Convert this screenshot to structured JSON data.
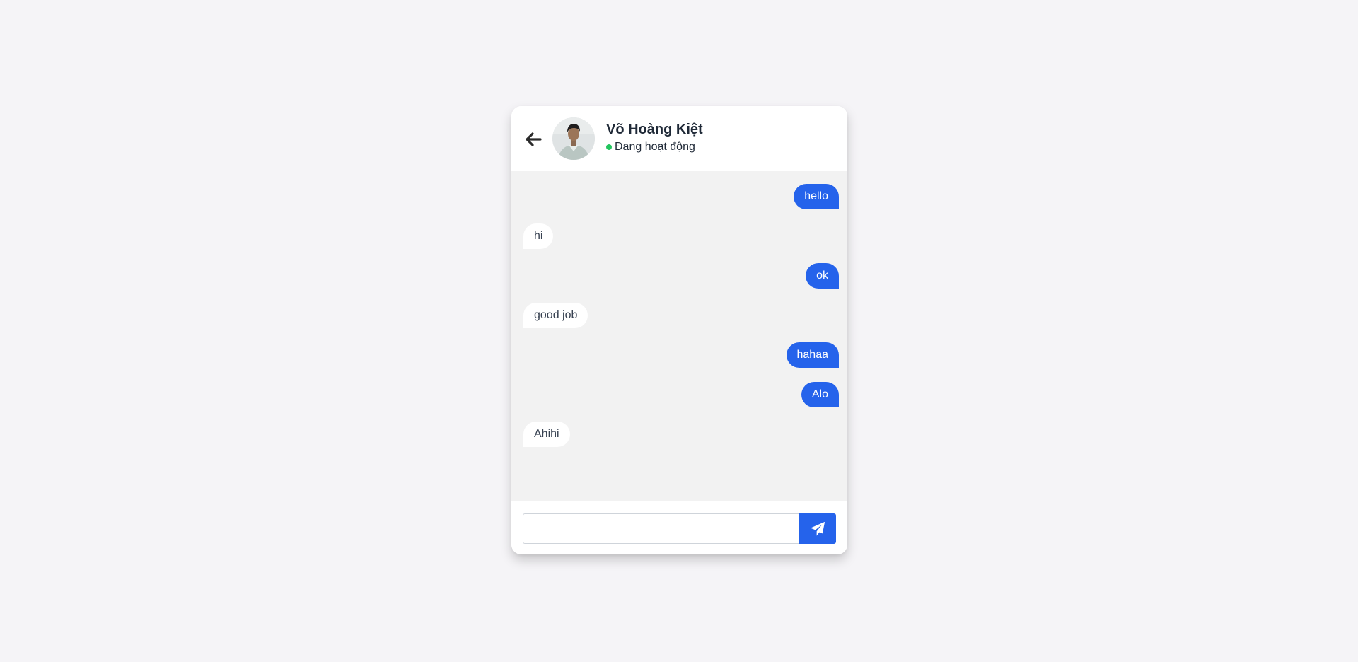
{
  "header": {
    "contact_name": "Võ Hoàng Kiệt",
    "status_text": "Đang hoạt động",
    "back_icon": "arrow-left-icon",
    "avatar": "contact-avatar-photo"
  },
  "messages": [
    {
      "text": "hello",
      "direction": "sent"
    },
    {
      "text": "hi",
      "direction": "received"
    },
    {
      "text": "ok",
      "direction": "sent"
    },
    {
      "text": "good job",
      "direction": "received"
    },
    {
      "text": "hahaa",
      "direction": "sent"
    },
    {
      "text": "Alo",
      "direction": "sent"
    },
    {
      "text": "Ahihi",
      "direction": "received"
    }
  ],
  "composer": {
    "input_value": "",
    "input_placeholder": "",
    "send_icon": "paper-plane-icon"
  },
  "colors": {
    "accent": "#2563eb",
    "online": "#22c55e",
    "page_background": "#f5f4f7",
    "messages_background": "#f2f2f2"
  }
}
